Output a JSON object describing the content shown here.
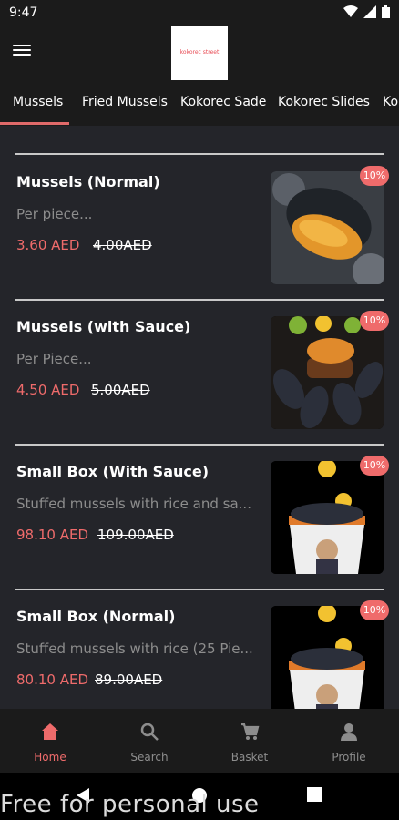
{
  "status": {
    "time": "9:47"
  },
  "logo": {
    "text": "kokorec street"
  },
  "tabs": [
    {
      "label": "Mussels"
    },
    {
      "label": "Fried Mussels"
    },
    {
      "label": "Kokorec Sade"
    },
    {
      "label": "Kokorec Slides"
    },
    {
      "label": "Ko"
    }
  ],
  "products": [
    {
      "name": "Mussels (Normal)",
      "desc": "Per piece...",
      "price": "3.60 AED",
      "old_price": "4.00AED",
      "discount": "10%"
    },
    {
      "name": "Mussels (with Sauce)",
      "desc": "Per Piece...",
      "price": "4.50 AED",
      "old_price": "5.00AED",
      "discount": "10%"
    },
    {
      "name": "Small Box (With Sauce)",
      "desc": "Stuffed mussels with rice and sa...",
      "price": "98.10 AED",
      "old_price": "109.00AED",
      "discount": "10%"
    },
    {
      "name": "Small Box (Normal)",
      "desc": "Stuffed mussels with rice (25 Pie...",
      "price": "80.10 AED",
      "old_price": "89.00AED",
      "discount": "10%"
    }
  ],
  "bottom_nav": [
    {
      "label": "Home",
      "icon": "home-icon",
      "active": true
    },
    {
      "label": "Search",
      "icon": "search-icon",
      "active": false
    },
    {
      "label": "Basket",
      "icon": "cart-icon",
      "active": false
    },
    {
      "label": "Profile",
      "icon": "person-icon",
      "active": false
    }
  ],
  "watermark": "Free for personal use",
  "colors": {
    "accent": "#ef6b6b",
    "background": "#24252a",
    "bar": "#1b1b1b"
  }
}
